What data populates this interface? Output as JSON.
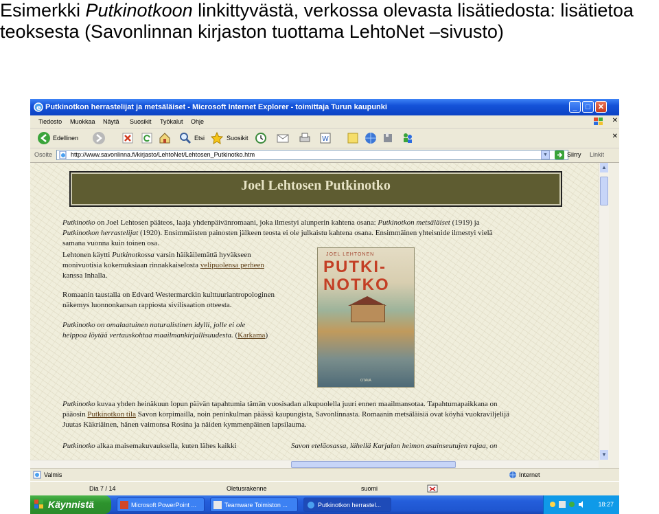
{
  "slide": {
    "title_part1": "Esimerkki ",
    "title_italic": "Putkinotkoon",
    "title_part2": " linkittyvästä, verkossa olevasta lisätiedosta: lisätietoa",
    "title_line2": "teoksesta (Savonlinnan kirjaston tuottama LehtoNet –sivusto)"
  },
  "browser": {
    "title": "Putkinotkon herrastelijat ja metsäläiset - Microsoft Internet Explorer - toimittaja Turun kaupunki",
    "menu": [
      "Tiedosto",
      "Muokkaa",
      "Näytä",
      "Suosikit",
      "Työkalut",
      "Ohje"
    ],
    "toolbar": {
      "back_label": "Edellinen",
      "search_label": "Etsi",
      "favorites_label": "Suosikit"
    },
    "address": {
      "label": "Osoite",
      "url": "http://www.savonlinna.fi/kirjasto/LehtoNet/Lehtosen_Putkinotko.htm",
      "go_label": "Siirry",
      "links_label": "Linkit"
    },
    "status": {
      "left": "Valmis",
      "right": "Internet"
    }
  },
  "page": {
    "banner_title": "Joel Lehtosen Putkinotko",
    "p1": {
      "i1": "Putkinotko",
      "t1": " on Joel Lehtosen pääteos, laaja yhdenpäivänromaani, joka ilmestyi alunperin kahtena osana: ",
      "i2": "Putkinotkon metsäläiset",
      "t2": " (1919) ja",
      "i3": "Putkinotkon herrastelijat",
      "t3": " (1920). Ensimmäisten painosten jälkeen teosta ei ole julkaistu kahtena osana. Ensimmäinen yhteisnide ilmestyi vielä",
      "t4": "samana vuonna kuin toinen osa."
    },
    "p2": {
      "t1": "Lehtonen käytti ",
      "i1": "Putkinotkossa",
      "t2": " varsin häikäilemättä hyväkseen",
      "t3": "monivuotisia kokemuksiaan rinnakkaiselosta ",
      "link": "velipuolensa perheen",
      "t4": "kanssa Inhalla."
    },
    "p3": {
      "line1": "Romaanin taustalla on Edvard Westermarckin kulttuuriantropologinen",
      "line2": "näkemys luonnonkansan rappiosta sivilisaation otteesta."
    },
    "p4": {
      "line1": "Putkinotko on omalaatuinen naturalistinen idylli, jolle ei ole",
      "line2": "helppoa löytää vertauskohtaa maailmankirjallisuudesta.",
      "paren_open": " (",
      "link": "Karkama",
      "paren_close": ")"
    },
    "p5": {
      "i1": "Putkinotko",
      "t1": " kuvaa yhden heinäkuun lopun päivän tapahtumia tämän vuosisadan alkupuolella juuri ennen maailmansotaa. Tapahtumapaikkana on",
      "t2": "pääosin ",
      "link": "Putkinotkon tila",
      "t3": " Savon korpimailla, noin peninkulman päässä kaupungista, Savonlinnasta. Romaanin metsäläisiä ovat köyhä vuokraviljelijä",
      "t4": "Juutas Käkriäinen, hänen vaimonsa Rosina ja näiden kymmenpäinen lapsilauma."
    },
    "p6": {
      "i1": "Putkinotko",
      "t1": " alkaa maisemakuvauksella, kuten lähes kaikki",
      "right": "Savon eteläosassa, lähellä Karjalan heimon asuinseutujen rajaa, on"
    },
    "book": {
      "author": "JOEL LEHTONEN",
      "title_line1": "PUTKI-",
      "title_line2": "NOTKO",
      "publisher": "OTAVA"
    }
  },
  "ppt_status": {
    "slide": "Dia 7 / 14",
    "design": "Oletusrakenne",
    "language": "suomi"
  },
  "taskbar": {
    "start": "Käynnistä",
    "tasks": [
      "Microsoft PowerPoint ...",
      "Teamware Toimiston ...",
      "Putkinotkon herrastel..."
    ],
    "clock": "18:27"
  }
}
